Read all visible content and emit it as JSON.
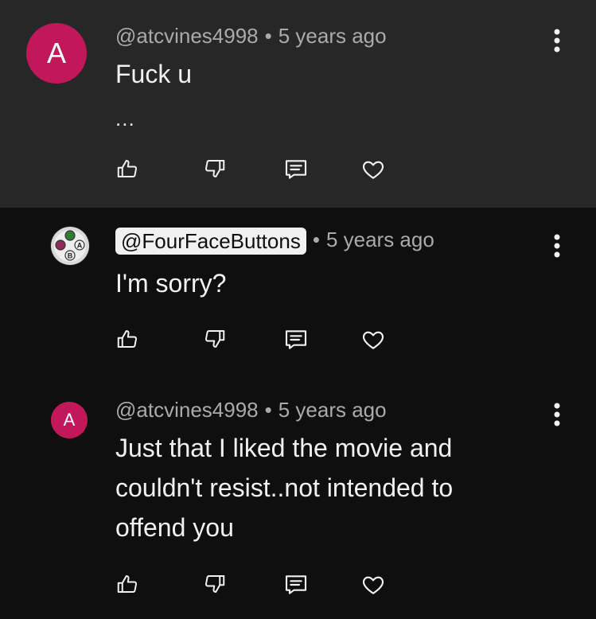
{
  "comments": [
    {
      "avatar_letter": "A",
      "avatar_color": "#c2185b",
      "author": "@atcvines4998",
      "separator": "•",
      "time": "5 years ago",
      "text": "Fuck u",
      "more_text": "...",
      "action_icons": [
        "thumbs-up-icon",
        "thumbs-down-icon",
        "reply-icon",
        "heart-icon"
      ]
    },
    {
      "avatar_icon": "controller-buttons-avatar",
      "author": "@FourFaceButtons",
      "separator": "•",
      "time": "5 years ago",
      "text": "I'm sorry?",
      "action_icons": [
        "thumbs-up-icon",
        "thumbs-down-icon",
        "reply-icon",
        "heart-icon"
      ]
    },
    {
      "avatar_letter": "A",
      "avatar_color": "#c2185b",
      "author": "@atcvines4998",
      "separator": "•",
      "time": "5 years ago",
      "text_lines": [
        "Just that I liked the movie and",
        "couldn't resist..not intended to",
        "offend you"
      ],
      "action_icons": [
        "thumbs-up-icon",
        "thumbs-down-icon",
        "reply-icon",
        "heart-icon"
      ]
    }
  ],
  "avatar_buttons": {
    "a": "A",
    "b": "B"
  }
}
